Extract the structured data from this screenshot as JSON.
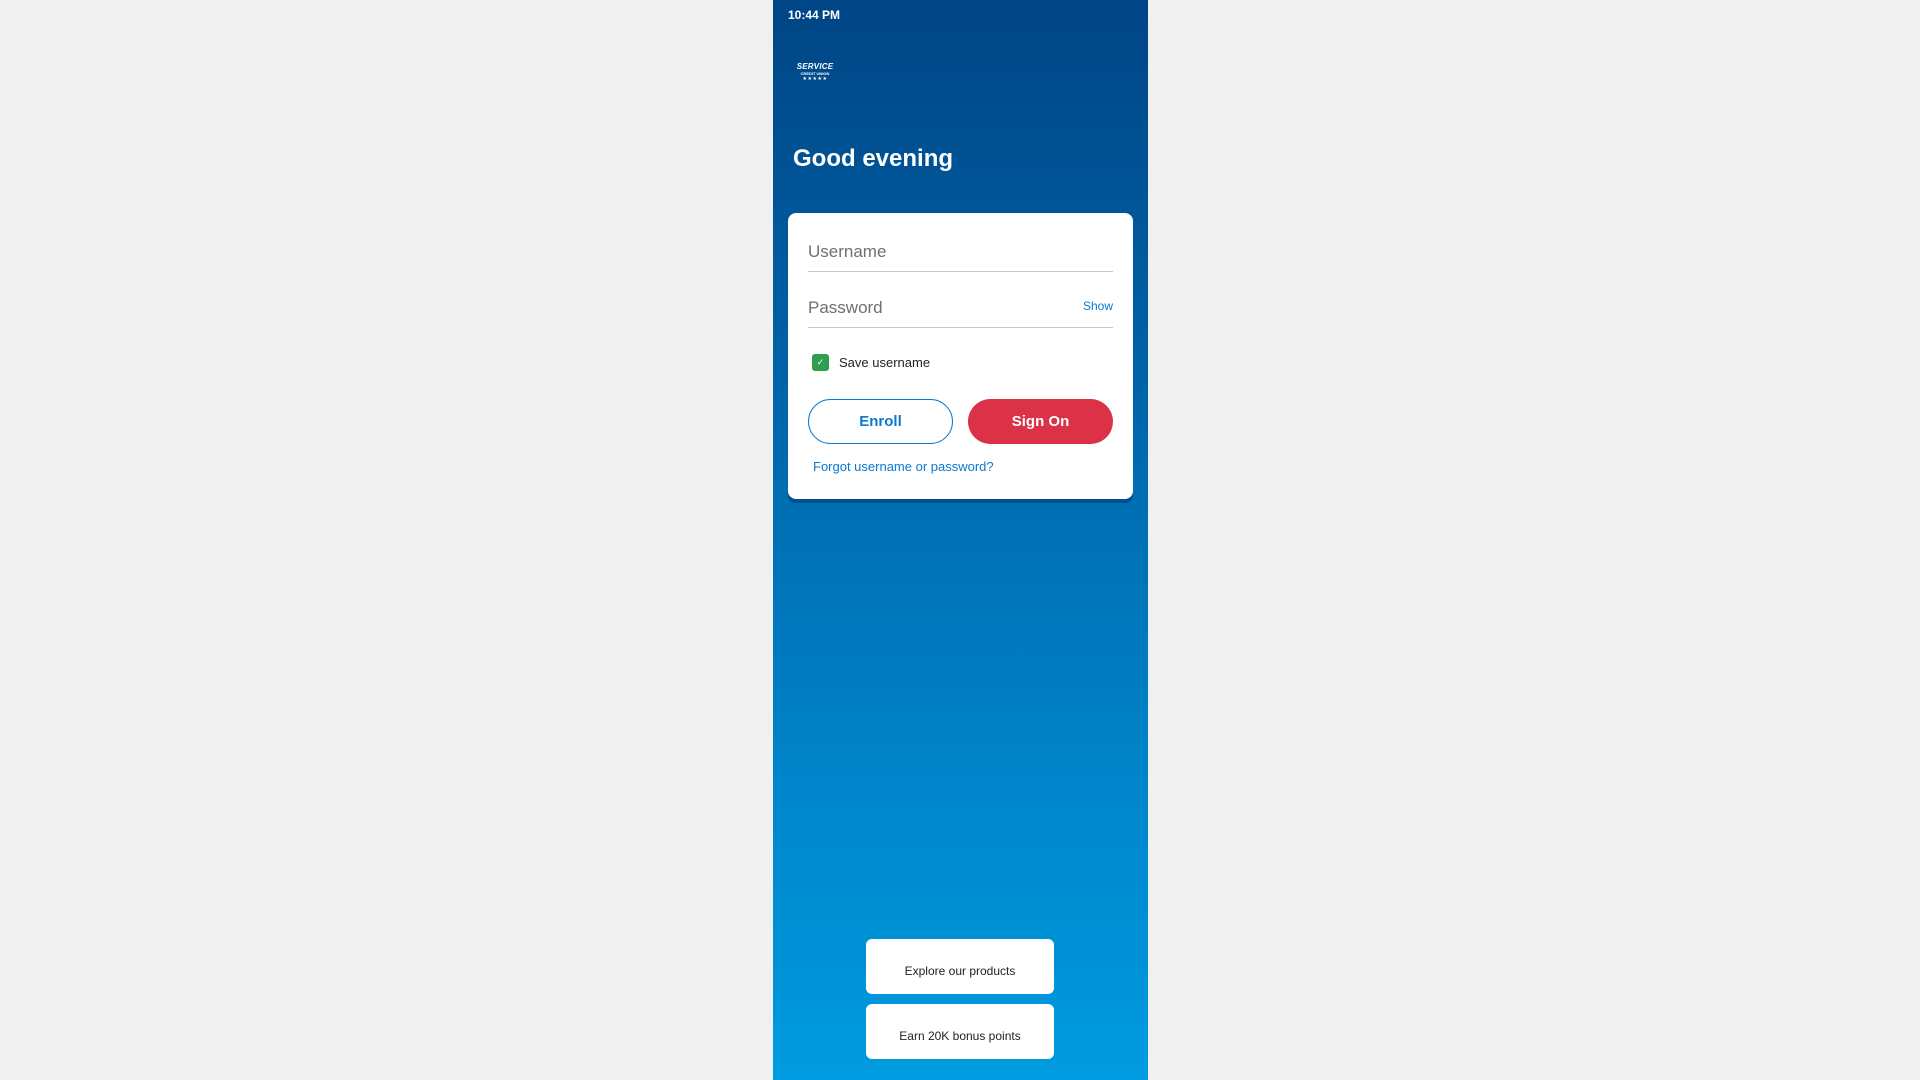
{
  "status_bar": {
    "time": "10:44 PM"
  },
  "logo": {
    "wordmark": "SERVICE",
    "subtitle": "CREDIT UNION",
    "stars": "★★★★★"
  },
  "greeting": "Good evening",
  "login": {
    "username_placeholder": "Username",
    "password_placeholder": "Password",
    "show_label": "Show",
    "save_username_label": "Save username",
    "save_username_checked": true,
    "enroll_label": "Enroll",
    "sign_on_label": "Sign On",
    "forgot_label": "Forgot username or password?"
  },
  "promos": [
    {
      "label": "Explore our products"
    },
    {
      "label": "Earn 20K bonus points"
    }
  ],
  "colors": {
    "gradient_top": "#004585",
    "gradient_bottom": "#009be0",
    "link_blue": "#0a79d1",
    "sign_on_red": "#dc3247",
    "checkbox_green": "#2e9e4f"
  }
}
